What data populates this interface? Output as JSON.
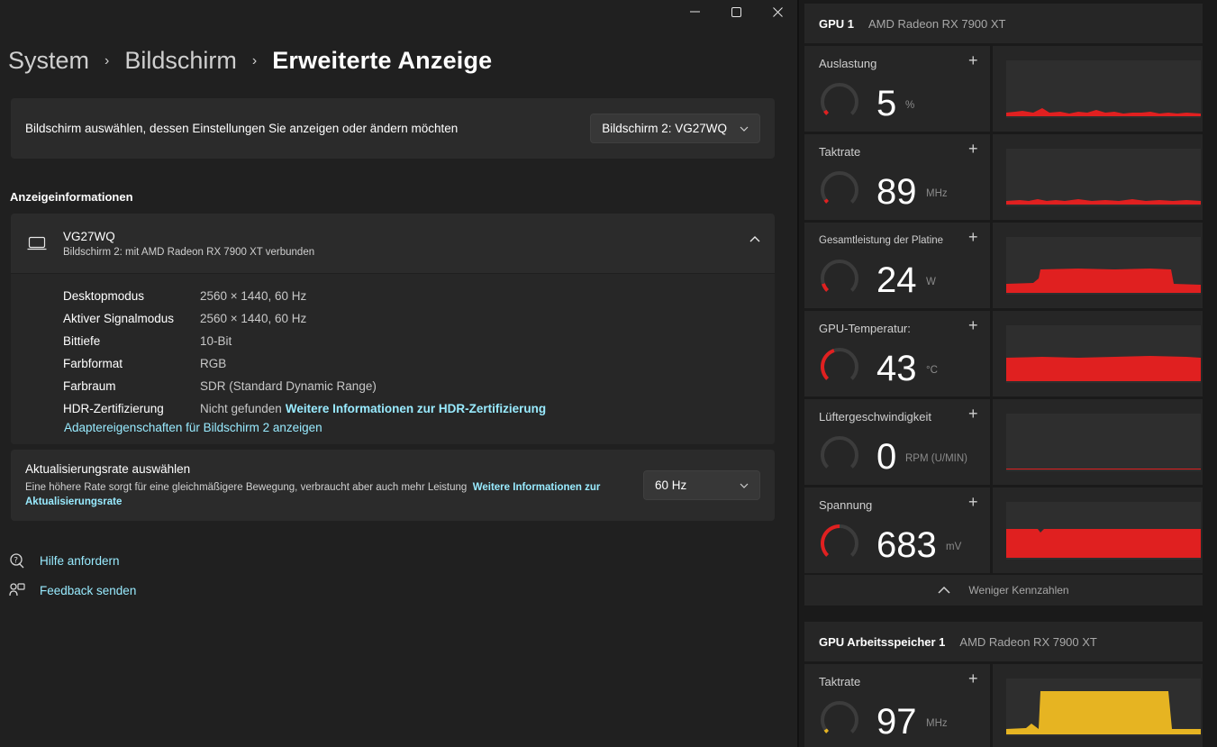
{
  "window_controls": {
    "minimize": "—",
    "maximize": "▢",
    "close": "✕"
  },
  "breadcrumb": {
    "items": [
      "System",
      "Bildschirm",
      "Erweiterte Anzeige"
    ],
    "separator": "›"
  },
  "display_select": {
    "label": "Bildschirm auswählen, dessen Einstellungen Sie anzeigen oder ändern möchten",
    "value": "Bildschirm 2: VG27WQ"
  },
  "display_info": {
    "section_title": "Anzeigeinformationen",
    "monitor_name": "VG27WQ",
    "monitor_subtitle": "Bildschirm 2: mit AMD Radeon RX 7900 XT verbunden",
    "rows": [
      {
        "key": "Desktopmodus",
        "value": "2560 × 1440, 60 Hz"
      },
      {
        "key": "Aktiver Signalmodus",
        "value": "2560 × 1440, 60 Hz"
      },
      {
        "key": "Bittiefe",
        "value": "10-Bit"
      },
      {
        "key": "Farbformat",
        "value": "RGB"
      },
      {
        "key": "Farbraum",
        "value": "SDR (Standard Dynamic Range)"
      },
      {
        "key": "HDR-Zertifizierung",
        "value": "Nicht gefunden",
        "link": "Weitere Informationen zur HDR-Zertifizierung"
      }
    ],
    "adapter_link": "Adaptereigenschaften für Bildschirm 2 anzeigen"
  },
  "refresh_rate": {
    "title": "Aktualisierungsrate auswählen",
    "description": "Eine höhere Rate sorgt für eine gleichmäßigere Bewegung, verbraucht aber auch mehr Leistung",
    "link": "Weitere Informationen zur Aktualisierungsrate",
    "value": "60 Hz"
  },
  "help_links": {
    "help": "Hilfe anfordern",
    "feedback": "Feedback senden"
  },
  "perf_panel": {
    "gpu": {
      "name": "GPU 1",
      "model": "AMD Radeon RX 7900 XT"
    },
    "metrics": [
      {
        "name": "Auslastung",
        "value": "5",
        "unit": "%",
        "gauge_fraction": 0.05,
        "color": "#e02020"
      },
      {
        "name": "Taktrate",
        "value": "89",
        "unit": "MHz",
        "gauge_fraction": 0.04,
        "color": "#e02020"
      },
      {
        "name": "Gesamtleistung der Platine",
        "value": "24",
        "unit": "W",
        "gauge_fraction": 0.1,
        "color": "#e02020"
      },
      {
        "name": "GPU-Temperatur:",
        "value": "43",
        "unit": "°C",
        "gauge_fraction": 0.43,
        "color": "#e02020"
      },
      {
        "name": "Lüftergeschwindigkeit",
        "value": "0",
        "unit": "RPM (U/MIN)",
        "gauge_fraction": 0.0,
        "color": "#e02020"
      },
      {
        "name": "Spannung",
        "value": "683",
        "unit": "mV",
        "gauge_fraction": 0.5,
        "color": "#e02020"
      }
    ],
    "less_label": "Weniger Kennzahlen",
    "memory": {
      "name": "GPU Arbeitsspeicher 1",
      "model": "AMD Radeon RX 7900 XT"
    },
    "memory_metrics": [
      {
        "name": "Taktrate",
        "value": "97",
        "unit": "MHz",
        "gauge_fraction": 0.04,
        "color": "#e6b422"
      }
    ],
    "plus_label": "+"
  }
}
